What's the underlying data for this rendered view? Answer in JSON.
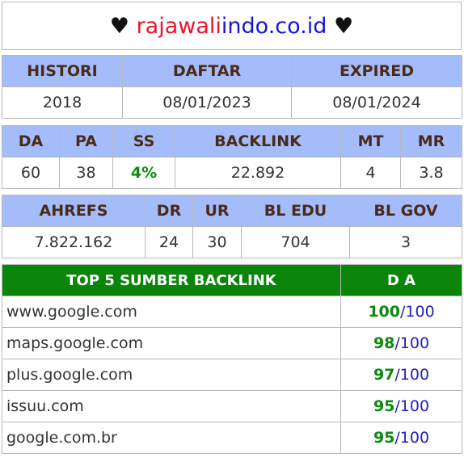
{
  "header": {
    "heart_left": "♥",
    "domain_part1": "rajawali",
    "domain_part2": "indo.co.id",
    "heart_right": "♥"
  },
  "dates": {
    "headers": [
      "HISTORI",
      "DAFTAR",
      "EXPIRED"
    ],
    "values": [
      "2018",
      "08/01/2023",
      "08/01/2024"
    ]
  },
  "metrics": {
    "headers": [
      "DA",
      "PA",
      "SS",
      "BACKLINK",
      "MT",
      "MR"
    ],
    "values": [
      "60",
      "38",
      "4%",
      "22.892",
      "4",
      "3.8"
    ]
  },
  "ahrefs": {
    "headers": [
      "AHREFS",
      "DR",
      "UR",
      "BL EDU",
      "BL GOV"
    ],
    "values": [
      "7.822.162",
      "24",
      "30",
      "704",
      "3"
    ]
  },
  "top_sources": {
    "header_site": "TOP 5 SUMBER BACKLINK",
    "header_da": "D A",
    "separator": "/",
    "rows": [
      {
        "site": "www.google.com",
        "da": "100",
        "max": "100"
      },
      {
        "site": "maps.google.com",
        "da": "98",
        "max": "100"
      },
      {
        "site": "plus.google.com",
        "da": "97",
        "max": "100"
      },
      {
        "site": "issuu.com",
        "da": "95",
        "max": "100"
      },
      {
        "site": "google.com.br",
        "da": "95",
        "max": "100"
      }
    ]
  }
}
